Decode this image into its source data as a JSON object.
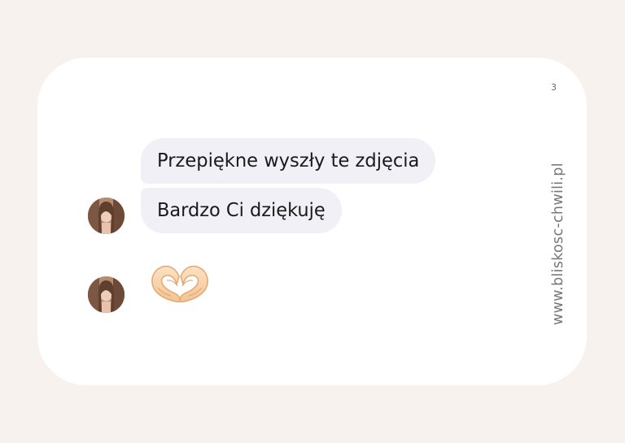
{
  "page_number": "3",
  "website": "www.bliskosc-chwili.pl",
  "messages": [
    {
      "text": "Przepiękne wyszły te zdjęcia"
    },
    {
      "text": "Bardzo Ci dziękuję"
    },
    {
      "emoji": "heart-hands"
    }
  ],
  "colors": {
    "page_background": "#f7f2ee",
    "card_background": "#ffffff",
    "bubble_background": "#f0f0f6",
    "text": "#1a1a1a",
    "muted_text": "#777777"
  }
}
